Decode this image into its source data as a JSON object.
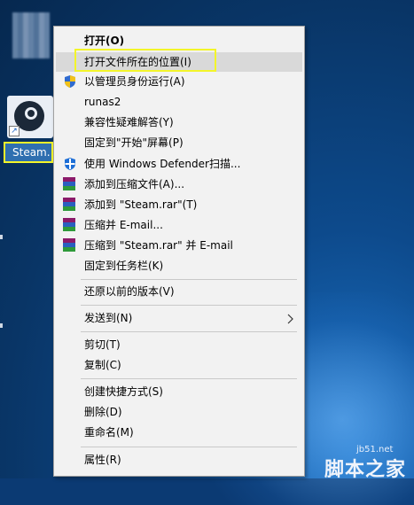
{
  "desktop": {
    "icon_label": "Steam."
  },
  "menu": {
    "items": [
      {
        "label": "打开(O)",
        "bold": true
      },
      {
        "label": "打开文件所在的位置(I)",
        "highlighted": true
      },
      {
        "label": "以管理员身份运行(A)",
        "icon": "shield-icon"
      },
      {
        "label": "runas2"
      },
      {
        "label": "兼容性疑难解答(Y)"
      },
      {
        "label": "固定到\"开始\"屏幕(P)"
      },
      {
        "label": "使用 Windows Defender扫描...",
        "icon": "defender-icon"
      },
      {
        "label": "添加到压缩文件(A)...",
        "icon": "winrar-icon"
      },
      {
        "label": "添加到 \"Steam.rar\"(T)",
        "icon": "winrar-icon"
      },
      {
        "label": "压缩并 E-mail...",
        "icon": "winrar-icon"
      },
      {
        "label": "压缩到 \"Steam.rar\" 并 E-mail",
        "icon": "winrar-icon"
      },
      {
        "label": "固定到任务栏(K)"
      },
      {
        "label": "还原以前的版本(V)"
      },
      {
        "label": "发送到(N)",
        "submenu": true
      },
      {
        "label": "剪切(T)"
      },
      {
        "label": "复制(C)"
      },
      {
        "label": "创建快捷方式(S)"
      },
      {
        "label": "删除(D)"
      },
      {
        "label": "重命名(M)"
      },
      {
        "label": "属性(R)"
      }
    ]
  },
  "watermark": {
    "site": "jb51.net",
    "brand": "脚本之家"
  },
  "colors": {
    "highlight_box": "#f3f52a",
    "menu_bg": "#f2f2f2",
    "desktop_bg": "#0b3a73"
  }
}
